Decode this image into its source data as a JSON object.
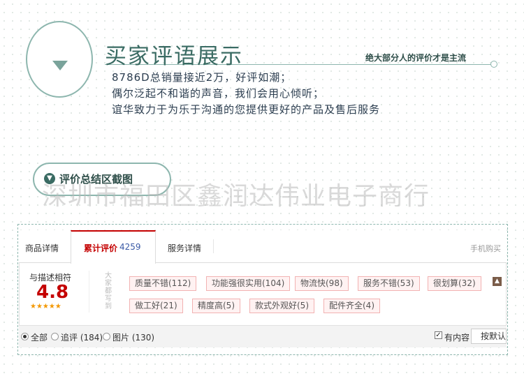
{
  "header": {
    "title": "买家评语展示",
    "subtitle_right": "绝大部分人的评价才是主流",
    "desc_line1": "8786D总销量接近2万，好评如潮；",
    "desc_line2": "偶尔泛起不和谐的声音，我们会用心倾听；",
    "desc_line3": "谊华致力于为乐于沟通的您提供更好的产品及售后服务"
  },
  "section": {
    "pill_label": "评价总结区截图",
    "pill_icon": "chevron-down-circle-icon",
    "watermark": "深圳市福田区鑫润达伟业电子商行"
  },
  "tabs": {
    "product_details": "商品详情",
    "reviews_label": "累计评价",
    "reviews_count": "4259",
    "service_details": "服务详情",
    "mobile_buy": "手机购买"
  },
  "rating": {
    "label": "与描述相符",
    "score": "4.8",
    "stars": "★★★★★",
    "stars_value": 4.8,
    "stars_max": 5
  },
  "tags_label": "大家都写到",
  "tags": [
    "质量不错(112)",
    "功能强很实用(104)",
    "物流快(98)",
    "服务不错(53)",
    "很划算(32)",
    "做工好(21)",
    "精度高(5)",
    "款式外观好(5)",
    "配件齐全(4)"
  ],
  "filters": {
    "all": "全部",
    "followup": "追评 (184)",
    "images": "图片 (130)",
    "has_content": "有内容",
    "has_content_checked": "✓",
    "sort_button": "按默认"
  },
  "colors": {
    "accent_teal": "#3a6b63",
    "active_red": "#c40000",
    "star_orange": "#f39800",
    "tag_border": "#f2b2b2"
  }
}
